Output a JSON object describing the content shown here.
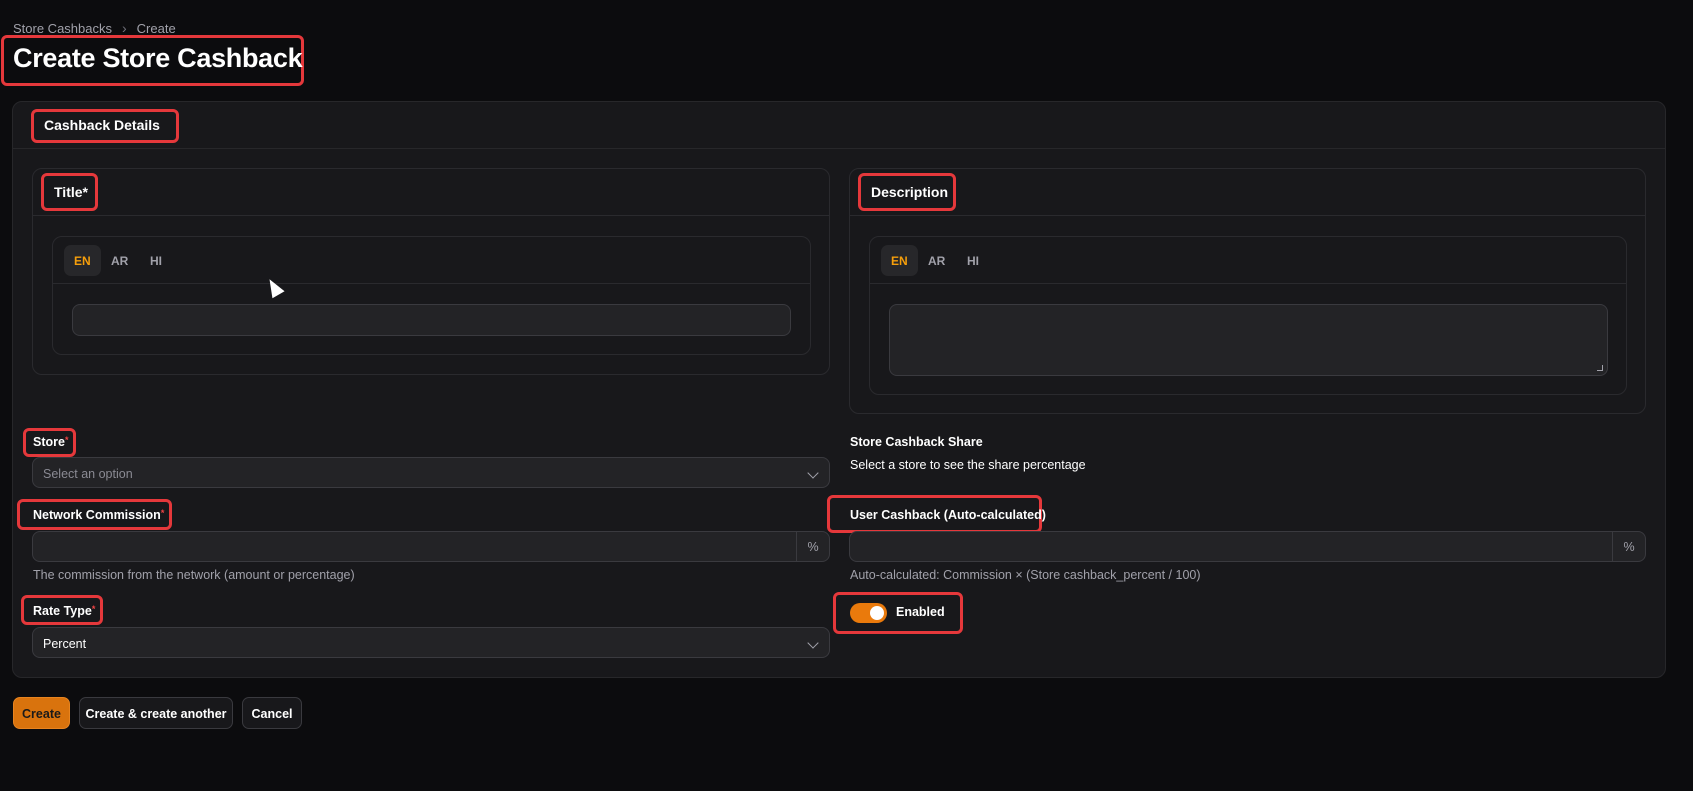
{
  "breadcrumb": {
    "parent": "Store Cashbacks",
    "current": "Create"
  },
  "page": {
    "title": "Create Store Cashback"
  },
  "section": {
    "title": "Cashback Details"
  },
  "title_field": {
    "label": "Title*",
    "tabs": [
      "EN",
      "AR",
      "HI"
    ],
    "active_tab": "EN",
    "value": ""
  },
  "description_field": {
    "label": "Description",
    "tabs": [
      "EN",
      "AR",
      "HI"
    ],
    "active_tab": "EN",
    "value": ""
  },
  "store": {
    "label": "Store",
    "placeholder": "Select an option"
  },
  "share": {
    "label": "Store Cashback Share",
    "hint": "Select a store to see the share percentage"
  },
  "network_commission": {
    "label": "Network Commission",
    "suffix": "%",
    "help": "The commission from the network (amount or percentage)"
  },
  "user_cashback": {
    "label": "User Cashback (Auto-calculated)",
    "suffix": "%",
    "help": "Auto-calculated: Commission × (Store cashback_percent / 100)"
  },
  "rate_type": {
    "label": "Rate Type",
    "value": "Percent"
  },
  "enabled": {
    "label": "Enabled",
    "on": true
  },
  "actions": {
    "create": "Create",
    "create_another": "Create & create another",
    "cancel": "Cancel"
  },
  "colors": {
    "accent": "#ea7a0c",
    "highlight": "#e5383b",
    "background": "#0c0c0e",
    "panel": "#18181b"
  }
}
